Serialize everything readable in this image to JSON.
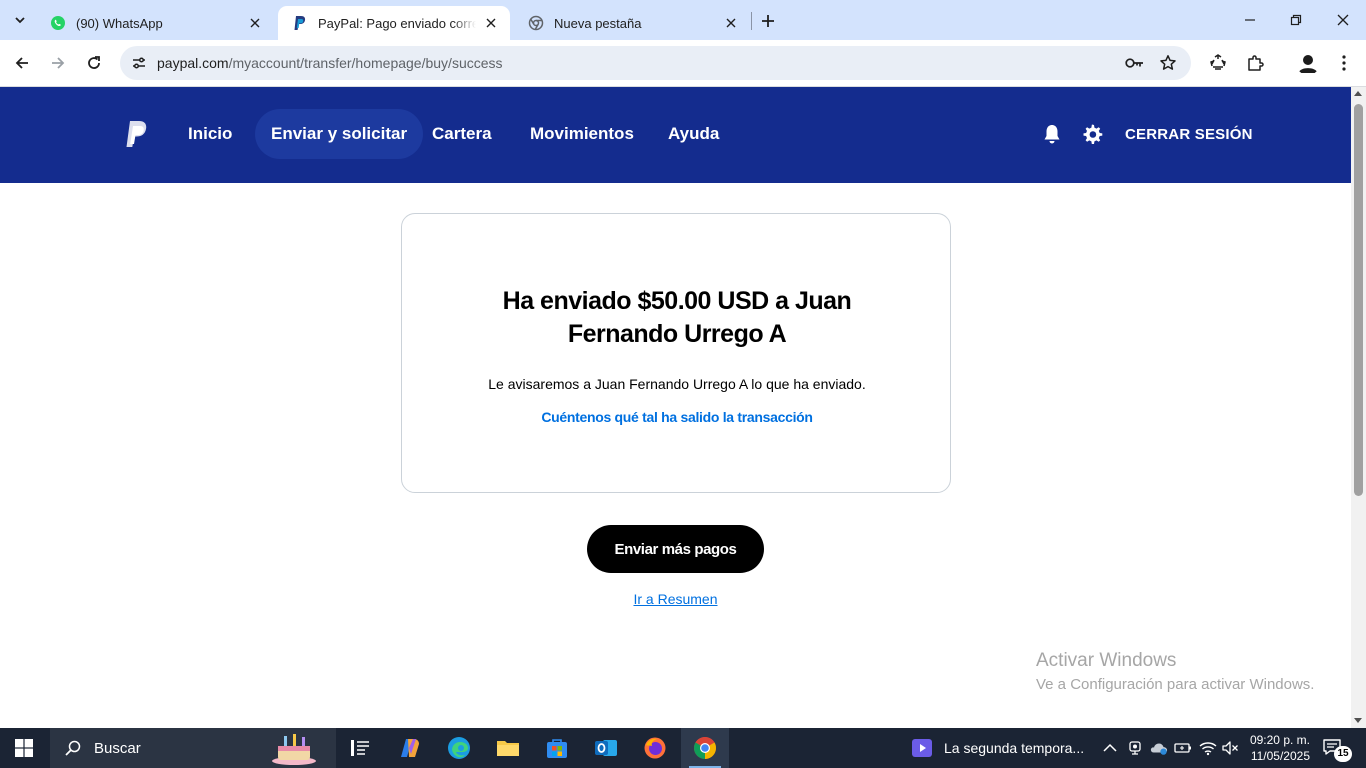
{
  "browser": {
    "tabs": [
      {
        "title": "(90) WhatsApp",
        "active": false
      },
      {
        "title": "PayPal: Pago enviado correctamente",
        "active": true
      },
      {
        "title": "Nueva pestaña",
        "active": false
      }
    ],
    "url_host": "paypal.com",
    "url_path": "/myaccount/transfer/homepage/buy/success"
  },
  "paypal": {
    "nav": [
      "Inicio",
      "Enviar y solicitar",
      "Cartera",
      "Movimientos",
      "Ayuda"
    ],
    "active_nav": "Enviar y solicitar",
    "logout": "CERRAR SESIÓN",
    "card_title": "Ha enviado $50.00 USD a Juan Fernando Urrego A",
    "card_notice": "Le avisaremos a Juan Fernando Urrego A lo que ha enviado.",
    "card_feedback": "Cuéntenos qué tal ha salido la transacción",
    "send_more": "Enviar más pagos",
    "go_summary": "Ir a Resumen"
  },
  "watermark": {
    "line1": "Activar Windows",
    "line2": "Ve a Configuración para activar Windows."
  },
  "taskbar": {
    "search_placeholder": "Buscar",
    "media_title": "La segunda tempora...",
    "time": "09:20 p. m.",
    "date": "11/05/2025",
    "notification_count": "15"
  },
  "colors": {
    "paypal_header": "#142c8e",
    "paypal_link": "#0070e0",
    "chrome_tabstrip": "#d3e3fd",
    "taskbar": "#1b2434"
  }
}
